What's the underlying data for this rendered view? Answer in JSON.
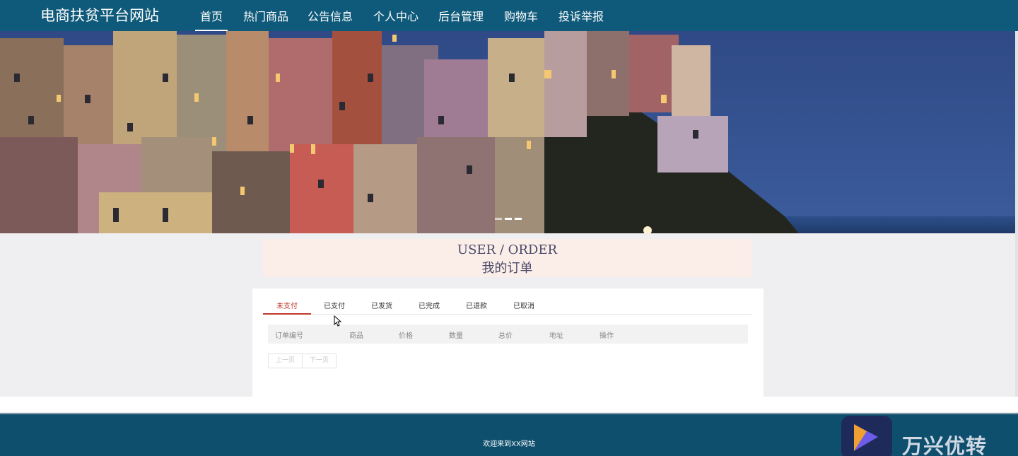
{
  "header": {
    "brand": "电商扶贫平台网站",
    "nav": [
      {
        "label": "首页",
        "active": true
      },
      {
        "label": "热门商品"
      },
      {
        "label": "公告信息"
      },
      {
        "label": "个人中心"
      },
      {
        "label": "后台管理"
      },
      {
        "label": "购物车"
      },
      {
        "label": "投诉举报"
      }
    ]
  },
  "banner": {
    "slides": 3,
    "active_slide": 1
  },
  "order": {
    "title_en": "USER / ORDER",
    "title_cn": "我的订单",
    "tabs": [
      "未支付",
      "已支付",
      "已发货",
      "已完成",
      "已退款",
      "已取消"
    ],
    "active_tab": "未支付",
    "columns": [
      "订单编号",
      "商品",
      "价格",
      "数量",
      "总价",
      "地址",
      "操作"
    ],
    "rows": [],
    "pager": {
      "prev": "上一页",
      "next": "下一页"
    }
  },
  "footer": {
    "text": "欢迎来到XX网站"
  },
  "watermark": {
    "text": "万兴优转"
  },
  "colors": {
    "nav": "#0f5a7a",
    "footer": "#0f4f6e",
    "accent": "#c0392b",
    "title_bg": "#fbeee8"
  }
}
